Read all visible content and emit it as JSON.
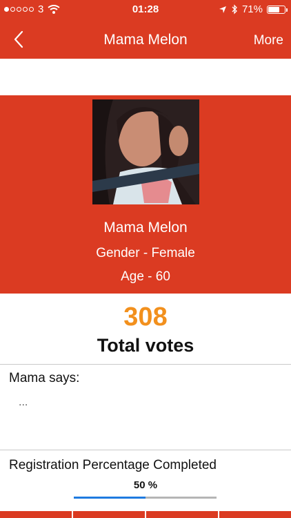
{
  "status_bar": {
    "carrier": "3",
    "time": "01:28",
    "battery": "71%",
    "battery_level": 0.71,
    "signal_bars": 1,
    "icons": [
      "wifi-icon",
      "location-arrow-icon",
      "bluetooth-icon",
      "battery-icon"
    ]
  },
  "nav": {
    "title": "Mama Melon",
    "more_label": "More",
    "back_icon": "chevron-left-icon"
  },
  "profile": {
    "name": "Mama Melon",
    "gender": "Gender - Female",
    "age": "Age - 60"
  },
  "votes": {
    "count": "308",
    "label": "Total votes"
  },
  "says": {
    "label": "Mama says:",
    "text": "..."
  },
  "registration": {
    "label": "Registration Percentage Completed",
    "value": "50 %",
    "fraction": 0.5
  },
  "colors": {
    "brand_red": "#db3b22",
    "votes_orange": "#f2901d",
    "progress_blue": "#1f7ae0"
  }
}
